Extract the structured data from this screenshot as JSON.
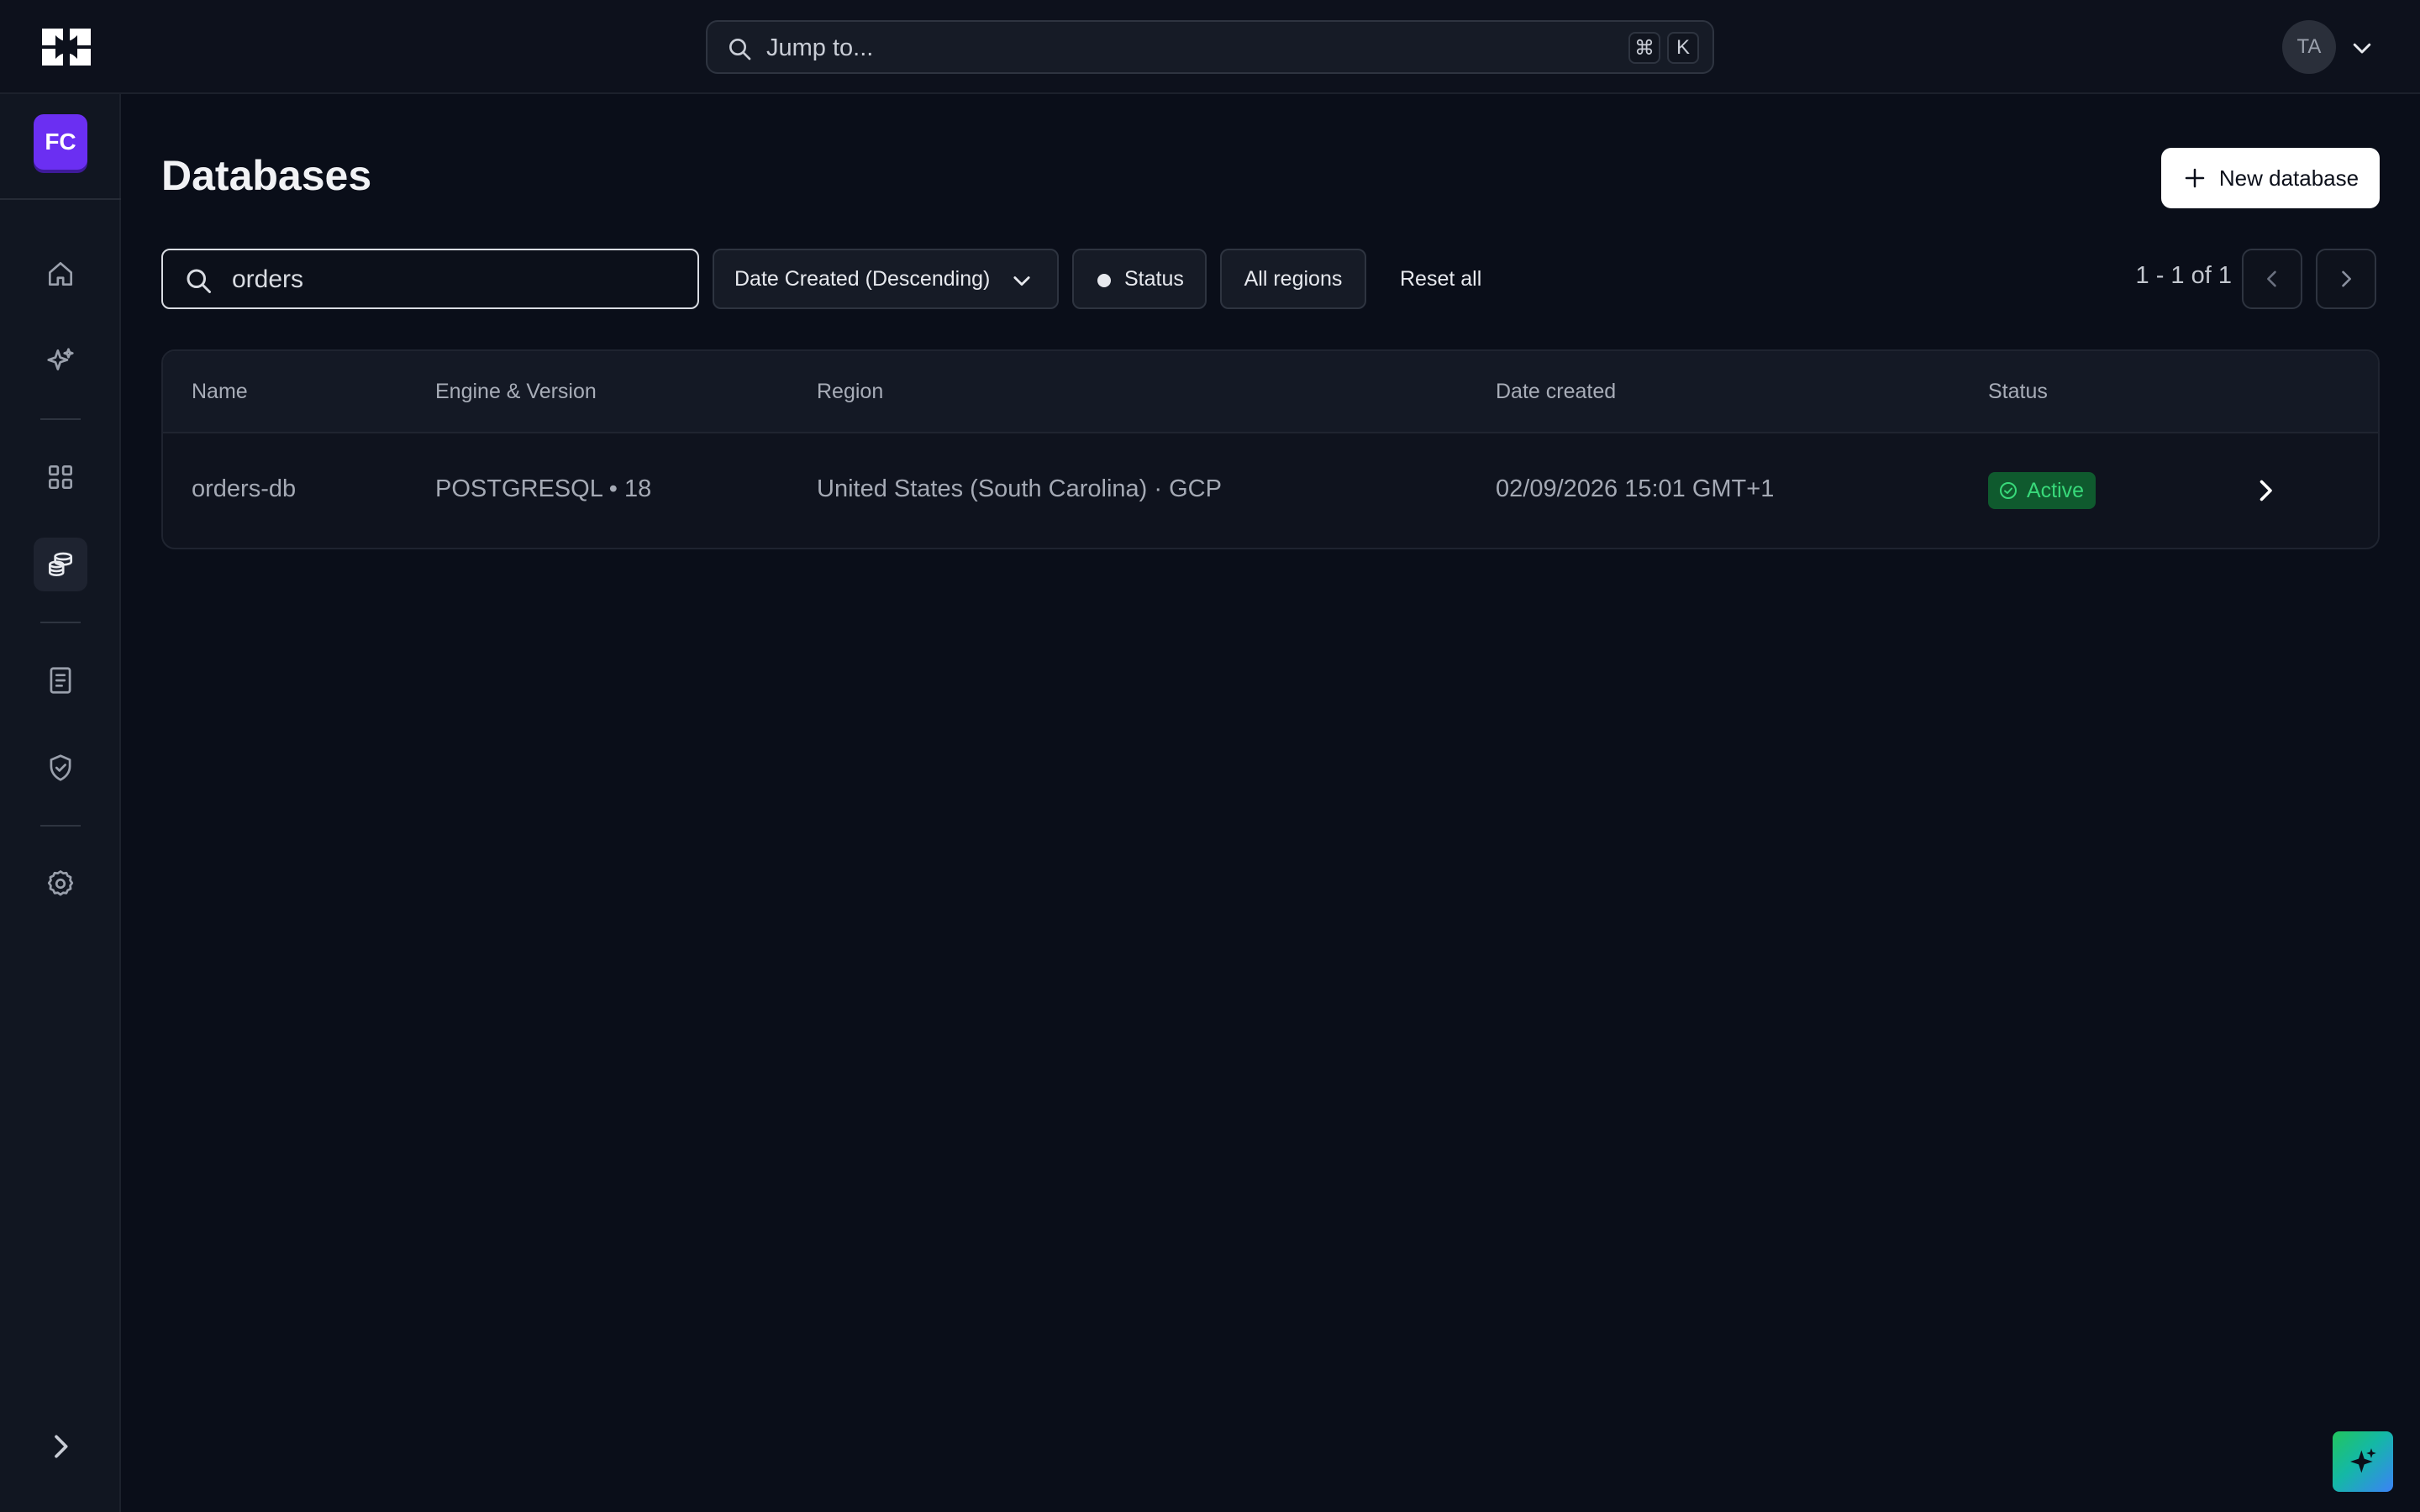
{
  "topbar": {
    "jump_placeholder": "Jump to...",
    "shortcut_cmd": "⌘",
    "shortcut_key": "K",
    "user_initials": "TA"
  },
  "sidebar": {
    "org_initials": "FC",
    "items": [
      {
        "name": "home",
        "icon": "home-icon"
      },
      {
        "name": "ai",
        "icon": "sparkles-icon"
      },
      {
        "name": "apps",
        "icon": "grid-icon"
      },
      {
        "name": "databases",
        "icon": "database-icon",
        "active": true
      },
      {
        "name": "docs",
        "icon": "document-icon"
      },
      {
        "name": "security",
        "icon": "shield-check-icon"
      },
      {
        "name": "settings",
        "icon": "gear-icon"
      }
    ]
  },
  "page": {
    "title": "Databases",
    "new_button": "New database"
  },
  "filters": {
    "search_value": "orders",
    "sort_label": "Date Created (Descending)",
    "status_label": "Status",
    "regions_label": "All regions",
    "reset_label": "Reset all"
  },
  "pagination": {
    "text": "1 - 1 of 1"
  },
  "table": {
    "headers": [
      "Name",
      "Engine & Version",
      "Region",
      "Date created",
      "Status"
    ],
    "rows": [
      {
        "name": "orders-db",
        "engine": "POSTGRESQL • 18",
        "region": "United States (South Carolina) · GCP",
        "created": "02/09/2026 15:01 GMT+1",
        "status": "Active"
      }
    ]
  },
  "colors": {
    "accent_purple": "#6b2ff2",
    "status_active_bg": "#0f5a2e",
    "status_active_text": "#38d97a",
    "background": "#0a0e19"
  }
}
